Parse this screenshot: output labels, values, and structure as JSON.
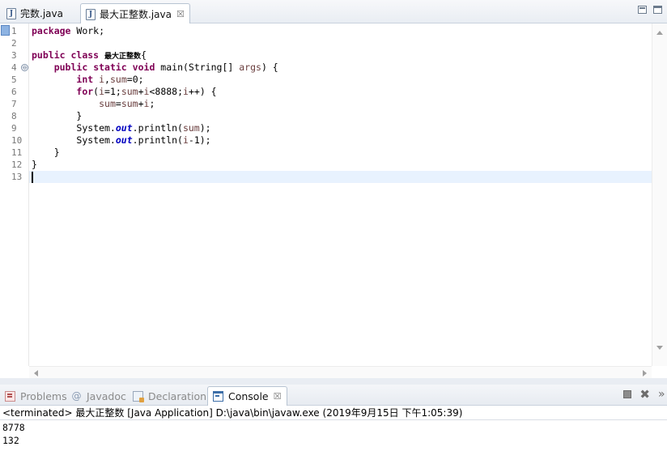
{
  "editor_tabs": [
    {
      "label": "完数.java",
      "active": false
    },
    {
      "label": "最大正整数.java",
      "active": true
    }
  ],
  "line_numbers": [
    "1",
    "2",
    "3",
    "4",
    "5",
    "6",
    "7",
    "8",
    "9",
    "10",
    "11",
    "12",
    "13"
  ],
  "code": {
    "l1": {
      "kw": "package",
      "rest": " Work;"
    },
    "l3": {
      "kw1": "public",
      "kw2": "class",
      "name": "最大正整数",
      "brace": "{"
    },
    "l4": {
      "kw1": "public",
      "kw2": "static",
      "kw3": "void",
      "rest1": " main(String[] ",
      "param": "args",
      "rest2": ") {"
    },
    "l5": {
      "kw": "int",
      "v1": "i",
      "sep": ",",
      "v2": "sum",
      "rest": "=0;"
    },
    "l6": {
      "kw": "for",
      "p1": "(",
      "v1": "i",
      "p2": "=1;",
      "v2": "sum",
      "p3": "+",
      "v3": "i",
      "p4": "<8888;",
      "v4": "i",
      "p5": "++) {"
    },
    "l7": {
      "v1": "sum",
      "p1": "=",
      "v2": "sum",
      "p2": "+",
      "v3": "i",
      "p3": ";"
    },
    "l8": "}",
    "l9": {
      "pre": "System.",
      "field": "out",
      "mid": ".println(",
      "v": "sum",
      "post": ");"
    },
    "l10": {
      "pre": "System.",
      "field": "out",
      "mid": ".println(",
      "v": "i",
      "post": "-1);"
    },
    "l11": "}",
    "l12": "}"
  },
  "panel_tabs": [
    {
      "label": "Problems",
      "icon": "problems-icon",
      "active": false
    },
    {
      "label": "Javadoc",
      "icon": "at-icon",
      "active": false
    },
    {
      "label": "Declaration",
      "icon": "declaration-icon",
      "active": false
    },
    {
      "label": "Console",
      "icon": "console-icon",
      "active": true
    }
  ],
  "console": {
    "description": "<terminated> 最大正整数 [Java Application] D:\\java\\bin\\javaw.exe (2019年9月15日 下午1:05:39)",
    "output": [
      "8778",
      "132"
    ]
  },
  "glyphs": {
    "close": "☒",
    "fold": "⊖",
    "javadoc": "@",
    "remove_all": "✖",
    "more": "»"
  }
}
